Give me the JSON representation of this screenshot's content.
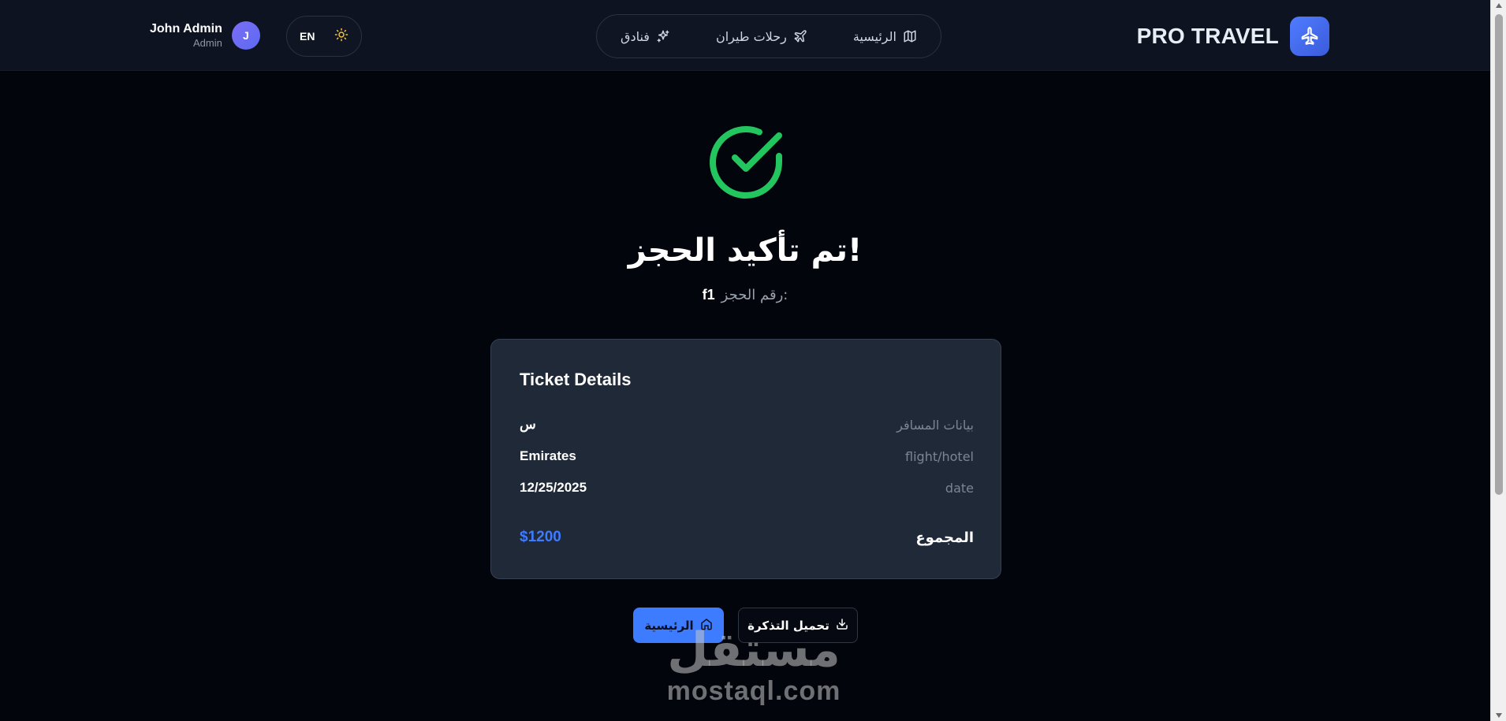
{
  "header": {
    "brand_name": "PRO TRAVEL",
    "nav": [
      {
        "label": "الرئيسية",
        "icon": "map-icon"
      },
      {
        "label": "رحلات طيران",
        "icon": "plane-icon"
      },
      {
        "label": "فنادق",
        "icon": "sparkles-icon"
      }
    ],
    "lang": "EN",
    "user": {
      "name": "John Admin",
      "role": "Admin",
      "initial": "J"
    }
  },
  "main": {
    "title": "تم تأكيد الحجز!",
    "booking_ref_label": "رقم الحجز:",
    "booking_ref_value": "f1"
  },
  "ticket": {
    "title": "Ticket Details",
    "rows": [
      {
        "label": "بيانات المسافر",
        "value": "س"
      },
      {
        "label": "flight/hotel",
        "value": "Emirates"
      },
      {
        "label": "date",
        "value": "12/25/2025"
      }
    ],
    "total_label": "المجموع",
    "total_value": "$1200"
  },
  "actions": {
    "download_label": "تحميل التذكرة",
    "home_label": "الرئيسية"
  },
  "watermark": {
    "arabic": "مستقل",
    "latin": "mostaql.com"
  },
  "colors": {
    "accent": "#3d7bff",
    "success": "#22c55e",
    "card": "#1f2937",
    "background": "#03050c"
  }
}
